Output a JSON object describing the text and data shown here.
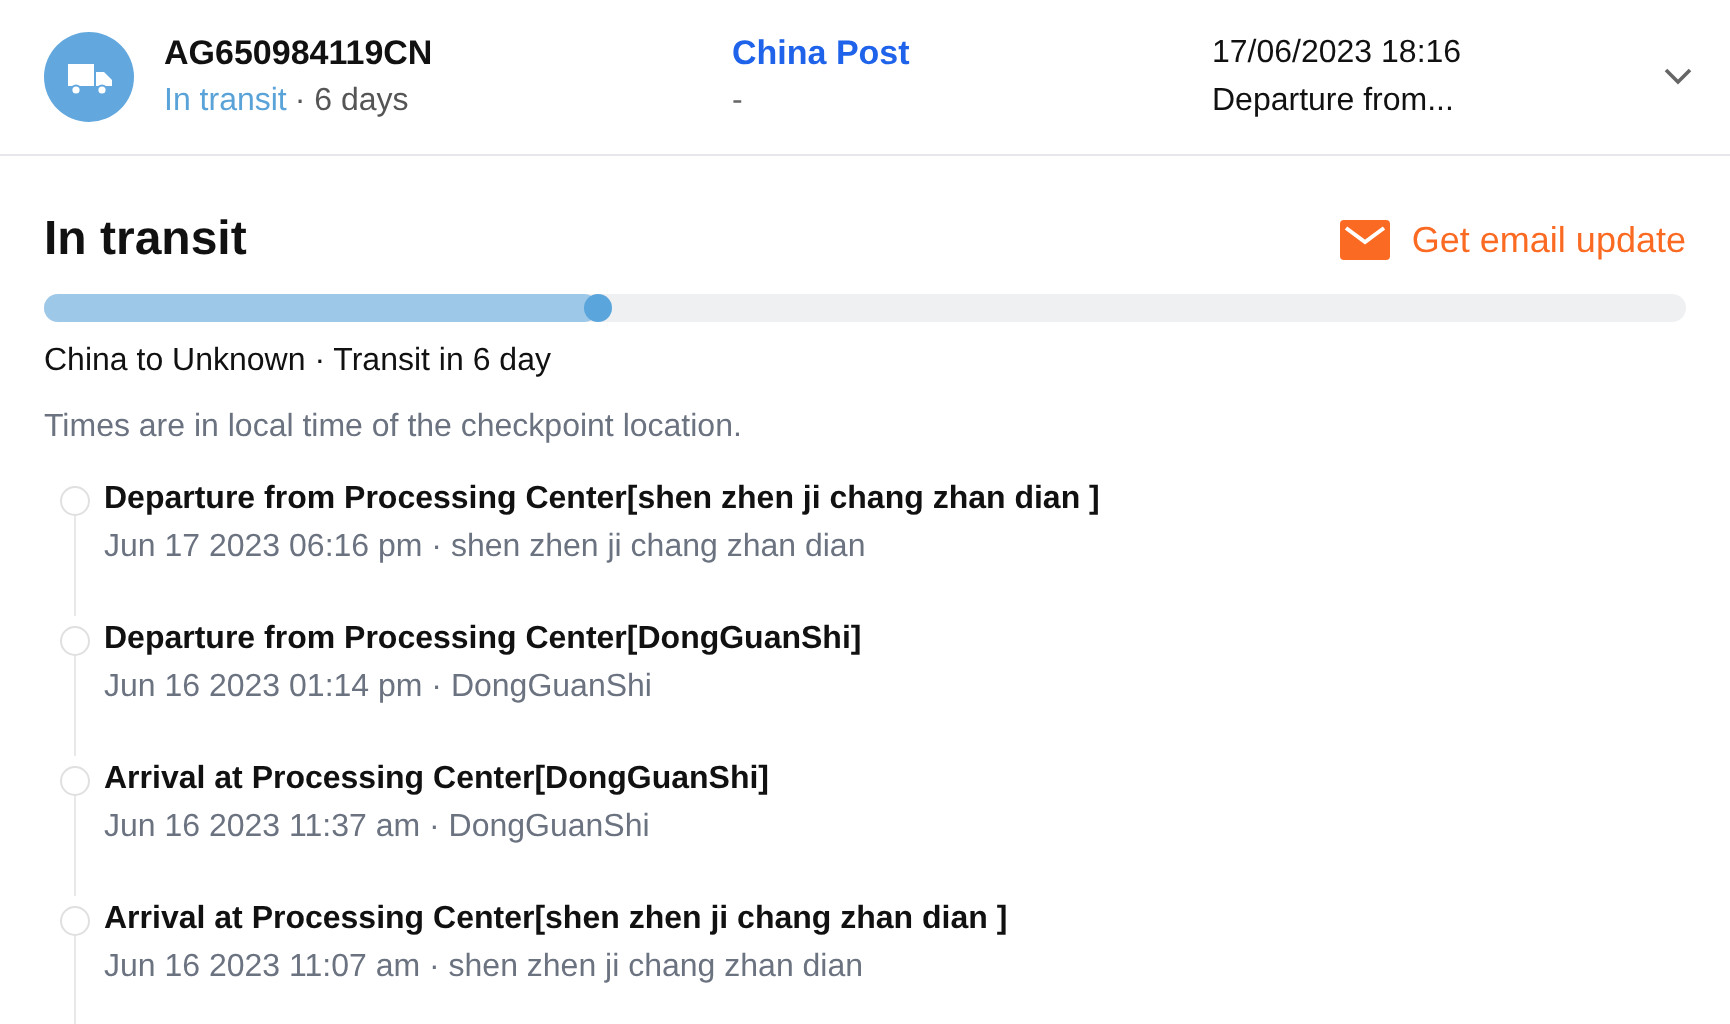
{
  "shipment": {
    "tracking_number": "AG650984119CN",
    "status": "In transit",
    "duration": "· 6 days",
    "carrier": "China Post",
    "carrier_sub": "-",
    "latest_time": "17/06/2023 18:16",
    "latest_event": "Departure from...",
    "expanded": false
  },
  "detail": {
    "title": "In transit",
    "email_button": "Get email update",
    "progress": {
      "level": 0.337
    },
    "route": "China to Unknown · Transit in 6 day",
    "note": "Times are in local time of the checkpoint location."
  },
  "events": [
    {
      "title": "Departure from Processing Center[shen zhen ji chang zhan dian ]",
      "subtitle": "Jun 17 2023 06:16 pm · shen zhen ji chang zhan dian"
    },
    {
      "title": "Departure from Processing Center[DongGuanShi]",
      "subtitle": "Jun 16 2023 01:14 pm · DongGuanShi"
    },
    {
      "title": "Arrival at Processing Center[DongGuanShi]",
      "subtitle": "Jun 16 2023 11:37 am · DongGuanShi"
    },
    {
      "title": "Arrival at Processing Center[shen zhen ji chang zhan dian ]",
      "subtitle": "Jun 16 2023 11:07 am · shen zhen ji chang zhan dian"
    }
  ]
}
